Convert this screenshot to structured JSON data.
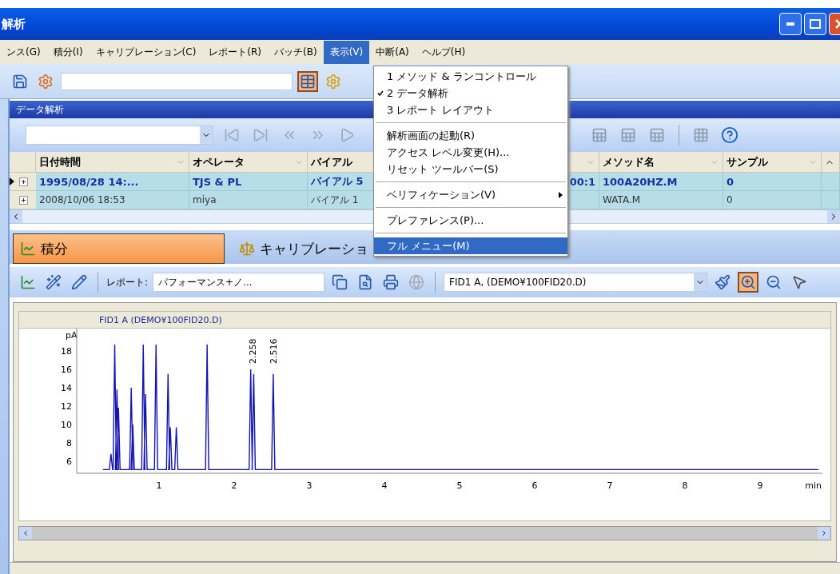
{
  "window": {
    "title": "解析"
  },
  "menu_bar": [
    {
      "label": "ンス(G)",
      "selected": false
    },
    {
      "label": "積分(I)",
      "selected": false
    },
    {
      "label": "キャリブレーション(C)",
      "selected": false
    },
    {
      "label": "レポート(R)",
      "selected": false
    },
    {
      "label": "バッチ(B)",
      "selected": false
    },
    {
      "label": "表示(V)",
      "selected": true
    },
    {
      "label": "中断(A)",
      "selected": false
    },
    {
      "label": "ヘルプ(H)",
      "selected": false
    }
  ],
  "view_menu": [
    {
      "kind": "item",
      "label": "1 メソッド & ランコントロール",
      "checked": false,
      "selected": false
    },
    {
      "kind": "item",
      "label": "2 データ解析",
      "checked": true,
      "selected": false
    },
    {
      "kind": "item",
      "label": "3 レポート レイアウト",
      "checked": false,
      "selected": false
    },
    {
      "kind": "separator"
    },
    {
      "kind": "item",
      "label": "解析画面の起動(R)",
      "checked": false,
      "selected": false
    },
    {
      "kind": "item",
      "label": "アクセス レベル変更(H)...",
      "checked": false,
      "selected": false
    },
    {
      "kind": "item",
      "label": "リセット ツールバー(S)",
      "checked": false,
      "selected": false
    },
    {
      "kind": "separator"
    },
    {
      "kind": "submenu",
      "label": "ベリフィケーション(V)",
      "checked": false,
      "selected": false
    },
    {
      "kind": "separator"
    },
    {
      "kind": "item",
      "label": "プレファレンス(P)...",
      "checked": false,
      "selected": false
    },
    {
      "kind": "separator"
    },
    {
      "kind": "item",
      "label": "フル メニュー(M)",
      "checked": false,
      "selected": true
    }
  ],
  "panel": {
    "title": "データ解析"
  },
  "table": {
    "columns": [
      {
        "kind": "text",
        "label": "日付時間"
      },
      {
        "kind": "text",
        "label": "オペレータ"
      },
      {
        "kind": "plain",
        "label": "バイアル"
      },
      {
        "kind": "blank"
      },
      {
        "kind": "text",
        "label": "メソッド名"
      },
      {
        "kind": "text",
        "label": "サンプル"
      }
    ],
    "rows": [
      {
        "selected": true,
        "cells": [
          "1995/08/28 14:...",
          "TJS & PL",
          "バイアル 5",
          "00:1",
          "100A20HZ.M",
          "0"
        ]
      },
      {
        "selected": false,
        "cells": [
          "2008/10/06 18:53",
          "miya",
          "バイアル 1",
          null,
          "WATA.M",
          "0"
        ]
      }
    ]
  },
  "tabs": [
    {
      "label": "積分",
      "selected": true
    },
    {
      "label": "キャリブレーショ",
      "selected": false
    }
  ],
  "analysis_toolbar": {
    "report_label": "レポート:",
    "report_value": "パフォーマンス+ノ...",
    "signal_value": "FID1 A, (DEMO¥100FID20.D)"
  },
  "chart": {
    "title": "FID1 A (DEMO¥100FID20.D)",
    "y_unit": "pA",
    "y_ticks": [
      "18",
      "16",
      "14",
      "12",
      "10",
      "8",
      "6"
    ],
    "x_ticks": [
      "1",
      "2",
      "3",
      "4",
      "5",
      "6",
      "7",
      "8",
      "9"
    ],
    "x_unit": "min",
    "peak_labels": [
      "2.258",
      "2.516"
    ]
  }
}
